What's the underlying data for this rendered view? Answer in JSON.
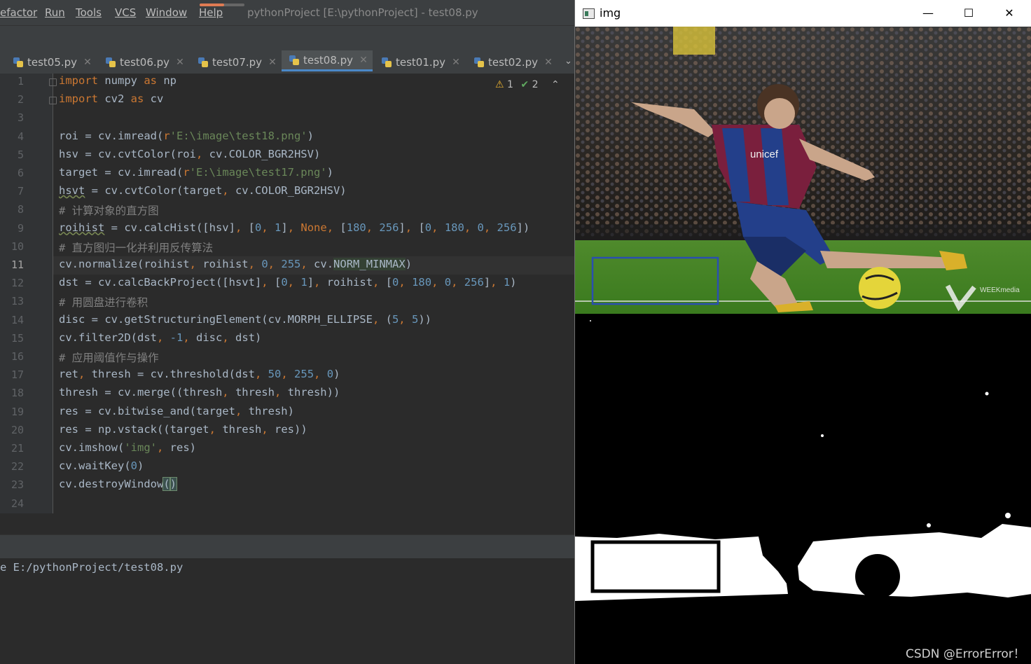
{
  "menu": {
    "items": [
      "efactor",
      "Run",
      "Tools",
      "VCS",
      "Window",
      "Help"
    ],
    "title": "pythonProject [E:\\pythonProject] - test08.py"
  },
  "tabs": [
    {
      "label": "test05.py",
      "active": false
    },
    {
      "label": "test06.py",
      "active": false
    },
    {
      "label": "test07.py",
      "active": false
    },
    {
      "label": "test08.py",
      "active": true
    },
    {
      "label": "test01.py",
      "active": false
    },
    {
      "label": "test02.py",
      "active": false
    }
  ],
  "inspection": {
    "warnings": "1",
    "ok": "2"
  },
  "editor": {
    "current_line": 11,
    "line_numbers": [
      "1",
      "2",
      "3",
      "4",
      "5",
      "6",
      "7",
      "8",
      "9",
      "10",
      "11",
      "12",
      "13",
      "14",
      "15",
      "16",
      "17",
      "18",
      "19",
      "20",
      "21",
      "22",
      "23",
      "24"
    ],
    "lines": [
      "import numpy as np",
      "import cv2 as cv",
      "",
      "roi = cv.imread(r'E:\\image\\test18.png')",
      "hsv = cv.cvtColor(roi, cv.COLOR_BGR2HSV)",
      "target = cv.imread(r'E:\\image\\test17.png')",
      "hsvt = cv.cvtColor(target, cv.COLOR_BGR2HSV)",
      "# 计算对象的直方图",
      "roihist = cv.calcHist([hsv], [0, 1], None, [180, 256], [0, 180, 0, 256])",
      "# 直方图归一化并利用反传算法",
      "cv.normalize(roihist, roihist, 0, 255, cv.NORM_MINMAX)",
      "dst = cv.calcBackProject([hsvt], [0, 1], roihist, [0, 180, 0, 256], 1)",
      "# 用圆盘进行卷积",
      "disc = cv.getStructuringElement(cv.MORPH_ELLIPSE, (5, 5))",
      "cv.filter2D(dst, -1, disc, dst)",
      "# 应用阈值作与操作",
      "ret, thresh = cv.threshold(dst, 50, 255, 0)",
      "thresh = cv.merge((thresh, thresh, thresh))",
      "res = cv.bitwise_and(target, thresh)",
      "res = np.vstack((target, thresh, res))",
      "cv.imshow('img', res)",
      "cv.waitKey(0)",
      "cv.destroyWindow()",
      ""
    ]
  },
  "run": {
    "command": "e E:/pythonProject/test08.py"
  },
  "cv_window": {
    "title": "img",
    "minimize": "—",
    "maximize": "☐",
    "close": "✕",
    "photo_texts": {
      "sponsor": "unicef",
      "logo": "WEEKmedia"
    }
  },
  "watermark": "CSDN @ErrorError！",
  "colors": {
    "keyword": "#cc7832",
    "string": "#6a8759",
    "number": "#6897bb",
    "comment": "#808080",
    "text": "#a9b7c6",
    "accent": "#4a88c7"
  }
}
